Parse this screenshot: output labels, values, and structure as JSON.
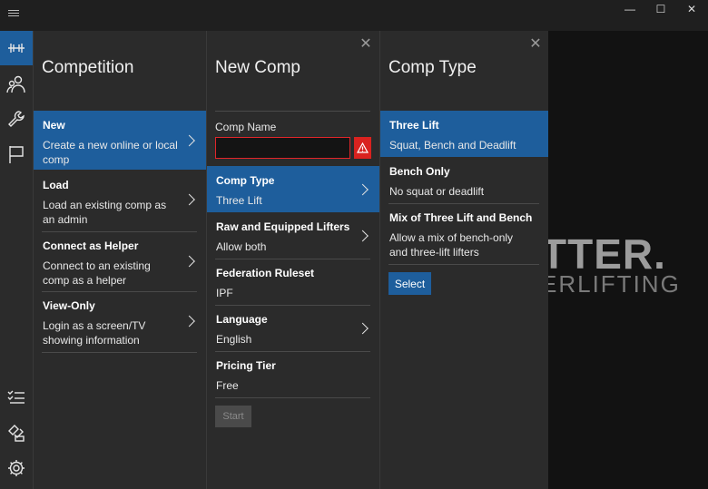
{
  "window": {
    "minimize_glyph": "—",
    "maximize_glyph": "☐",
    "close_glyph": "✕"
  },
  "rail": {
    "items": [
      {
        "icon": "barbell-icon",
        "active": true
      },
      {
        "icon": "people-icon"
      },
      {
        "icon": "wrench-icon"
      },
      {
        "icon": "flag-icon"
      },
      {
        "icon": "checklist-icon"
      },
      {
        "icon": "feedback-icon"
      },
      {
        "icon": "gear-icon"
      }
    ]
  },
  "background": {
    "logo_text": "TTER",
    "logo_dot": ".",
    "logo_sub": "ERLIFTING"
  },
  "competition": {
    "title": "Competition",
    "items": [
      {
        "head": "New",
        "sub": "Create a new online or local comp"
      },
      {
        "head": "Load",
        "sub": "Load an existing comp as an admin"
      },
      {
        "head": "Connect as Helper",
        "sub": "Connect to an existing comp as a helper"
      },
      {
        "head": "View-Only",
        "sub": "Login as a screen/TV showing information"
      }
    ]
  },
  "new_comp": {
    "title": "New Comp",
    "close_glyph": "✕",
    "comp_name_label": "Comp Name",
    "comp_name_value": "",
    "items": [
      {
        "head": "Comp Type",
        "sub": "Three Lift"
      },
      {
        "head": "Raw and Equipped Lifters",
        "sub": "Allow both"
      },
      {
        "head": "Federation Ruleset",
        "sub": "IPF"
      },
      {
        "head": "Language",
        "sub": "English"
      },
      {
        "head": "Pricing Tier",
        "sub": "Free"
      }
    ],
    "start_label": "Start"
  },
  "comp_type": {
    "title": "Comp Type",
    "close_glyph": "✕",
    "items": [
      {
        "head": "Three Lift",
        "sub": "Squat, Bench and Deadlift"
      },
      {
        "head": "Bench Only",
        "sub": "No squat or deadlift"
      },
      {
        "head": "Mix of Three Lift and Bench",
        "sub": "Allow a mix of bench-only and three-lift lifters"
      }
    ],
    "select_label": "Select"
  },
  "colors": {
    "accent": "#1e5e9c",
    "error": "#d9221f",
    "panel_bg": "#2b2b2b"
  }
}
